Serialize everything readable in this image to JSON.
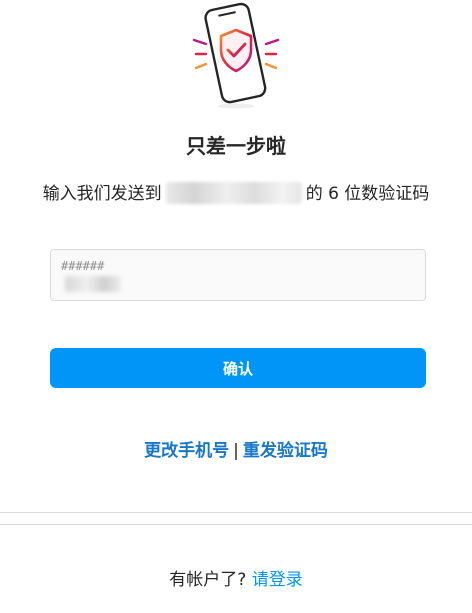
{
  "header": {
    "illustration_icon": "phone-shield-check-icon"
  },
  "main": {
    "title": "只差一步啦",
    "description_prefix": "输入我们发送到",
    "description_suffix": "的 6 位数验证码",
    "code_input": {
      "placeholder": "######",
      "value": ""
    },
    "confirm_label": "确认",
    "change_phone_label": "更改手机号",
    "separator": "|",
    "resend_code_label": "重发验证码"
  },
  "footer": {
    "prompt": "有帐户了?",
    "login_label": "请登录"
  },
  "colors": {
    "accent": "#0095f6",
    "link": "#1877c9",
    "text": "#262626",
    "border": "#dbdbdb",
    "input_bg": "#fafafa",
    "shield_gradient_start": "#f09433",
    "shield_gradient_end": "#bc1888"
  }
}
